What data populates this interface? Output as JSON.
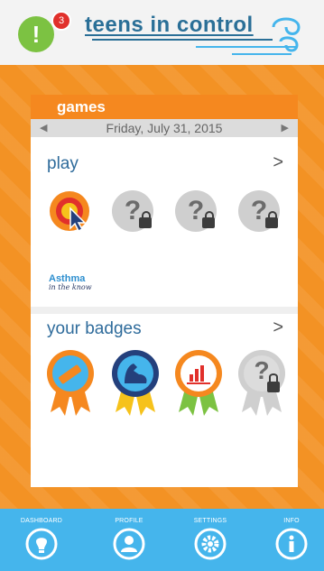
{
  "header": {
    "brand": "teens in control",
    "alert_icon_glyph": "!",
    "alert_count": "3"
  },
  "card": {
    "title": "games",
    "date": "Friday, July 31, 2015",
    "date_prev": "◀",
    "date_next": "▶"
  },
  "play": {
    "title": "play",
    "more": ">",
    "games": [
      {
        "name": "Asthma",
        "tagline": "in the know",
        "icon": "target-cursor-icon",
        "locked": false
      },
      {
        "icon": "locked-question-icon",
        "locked": true,
        "glyph": "?"
      },
      {
        "icon": "locked-question-icon",
        "locked": true,
        "glyph": "?"
      },
      {
        "icon": "locked-question-icon",
        "locked": true,
        "glyph": "?"
      }
    ]
  },
  "badges": {
    "title": "your badges",
    "more": ">",
    "items": [
      {
        "icon": "inhaler-badge-icon",
        "colors": [
          "#f5881f",
          "#2e8fcf"
        ]
      },
      {
        "icon": "muscle-badge-icon",
        "colors": [
          "#f6c21b",
          "#24407c"
        ]
      },
      {
        "icon": "chart-badge-icon",
        "colors": [
          "#7cc242",
          "#f5881f"
        ]
      },
      {
        "icon": "locked-badge-icon",
        "colors": [
          "#cfcfcf",
          "#9a9a9a"
        ],
        "glyph": "?"
      }
    ]
  },
  "nav": {
    "items": [
      {
        "label": "DASHBOARD",
        "icon": "bulb-icon"
      },
      {
        "label": "PROFILE",
        "icon": "user-icon"
      },
      {
        "label": "SETTINGS",
        "icon": "gear-icon"
      },
      {
        "label": "INFO",
        "icon": "info-icon"
      }
    ]
  },
  "colors": {
    "orange": "#f39224",
    "card_header": "#f5881f",
    "nav": "#45b5ec",
    "brand": "#2a6f97",
    "alert": "#7cc242",
    "badge": "#e1302b"
  }
}
